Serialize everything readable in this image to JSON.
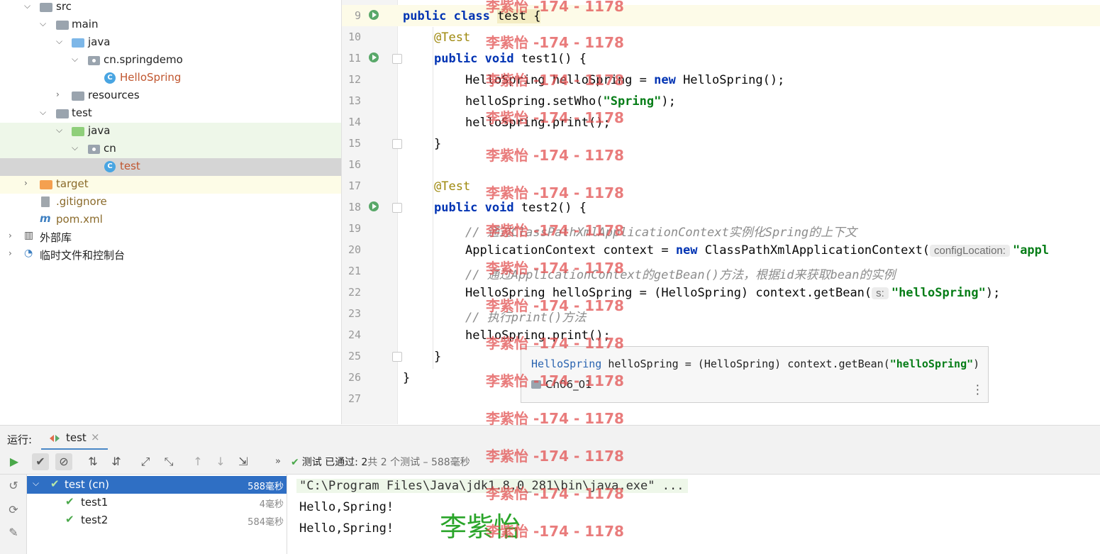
{
  "tree": {
    "items": [
      {
        "label": "src"
      },
      {
        "label": "main"
      },
      {
        "label": "java"
      },
      {
        "label": "cn.springdemo"
      },
      {
        "label": "HelloSpring"
      },
      {
        "label": "resources"
      },
      {
        "label": "test"
      },
      {
        "label": "java"
      },
      {
        "label": "cn"
      },
      {
        "label": "test"
      },
      {
        "label": "target"
      },
      {
        "label": ".gitignore"
      },
      {
        "label": "pom.xml"
      },
      {
        "label": "外部库"
      },
      {
        "label": "临时文件和控制台"
      }
    ]
  },
  "editor": {
    "lines": [
      {
        "num": "9"
      },
      {
        "num": "10"
      },
      {
        "num": "11"
      },
      {
        "num": "12"
      },
      {
        "num": "13"
      },
      {
        "num": "14"
      },
      {
        "num": "15"
      },
      {
        "num": "16"
      },
      {
        "num": "17"
      },
      {
        "num": "18"
      },
      {
        "num": "19"
      },
      {
        "num": "20"
      },
      {
        "num": "21"
      },
      {
        "num": "22"
      },
      {
        "num": "23"
      },
      {
        "num": "24"
      },
      {
        "num": "25"
      },
      {
        "num": "26"
      },
      {
        "num": "27"
      }
    ],
    "code": {
      "l9_kw": "public class ",
      "l9_name": "test {",
      "l10": "@Test",
      "l11_kw": "public void ",
      "l11_rest": "test1() {",
      "l12_a": "HelloSpring helloSpring = ",
      "l12_kw": "new",
      "l12_b": " HelloSpring();",
      "l13_a": "helloSpring.setWho(",
      "l13_str": "\"Spring\"",
      "l13_b": ");",
      "l14": "helloSpring.print();",
      "l15": "}",
      "l17": "@Test",
      "l18_kw": "public void ",
      "l18_rest": "test2() {",
      "l19": "// 通过ClassPathXmlApplicationContext实例化Spring的上下文",
      "l20_a": "ApplicationContext context = ",
      "l20_kw": "new",
      "l20_b": " ClassPathXmlApplicationContext(",
      "l20_hint": "configLocation:",
      "l20_str": "\"appl",
      "l21": "// 通过ApplicationContext的getBean()方法，根据id来获取bean的实例",
      "l22_a": "HelloSpring helloSpring = (HelloSpring) context.getBean(",
      "l22_hint": "s:",
      "l22_str": "\"helloSpring\"",
      "l22_b": ");",
      "l23": "// 执行print()方法",
      "l24": "helloSpring.print();",
      "l25": "}",
      "l26": "}"
    },
    "popup": {
      "type": "HelloSpring",
      "signature": " helloSpring = (HelloSpring) context.getBean(",
      "sig_str": "\"helloSpring\"",
      "sig_end": ")",
      "module": "Ch06_01"
    }
  },
  "run": {
    "label": "运行:",
    "tab": "test",
    "status_prefix": "测试 已通过: 2",
    "status_rest": "共 2 个测试 – 588毫秒",
    "results": [
      {
        "name": "test (cn)",
        "time": "588毫秒"
      },
      {
        "name": "test1",
        "time": "4毫秒"
      },
      {
        "name": "test2",
        "time": "584毫秒"
      }
    ],
    "console": [
      "\"C:\\Program Files\\Java\\jdk1.8.0_281\\bin\\java.exe\" ...",
      "Hello,Spring!",
      "Hello,Spring!"
    ],
    "signature": "李紫怡"
  },
  "watermark": "李紫怡 -174 - 1178"
}
